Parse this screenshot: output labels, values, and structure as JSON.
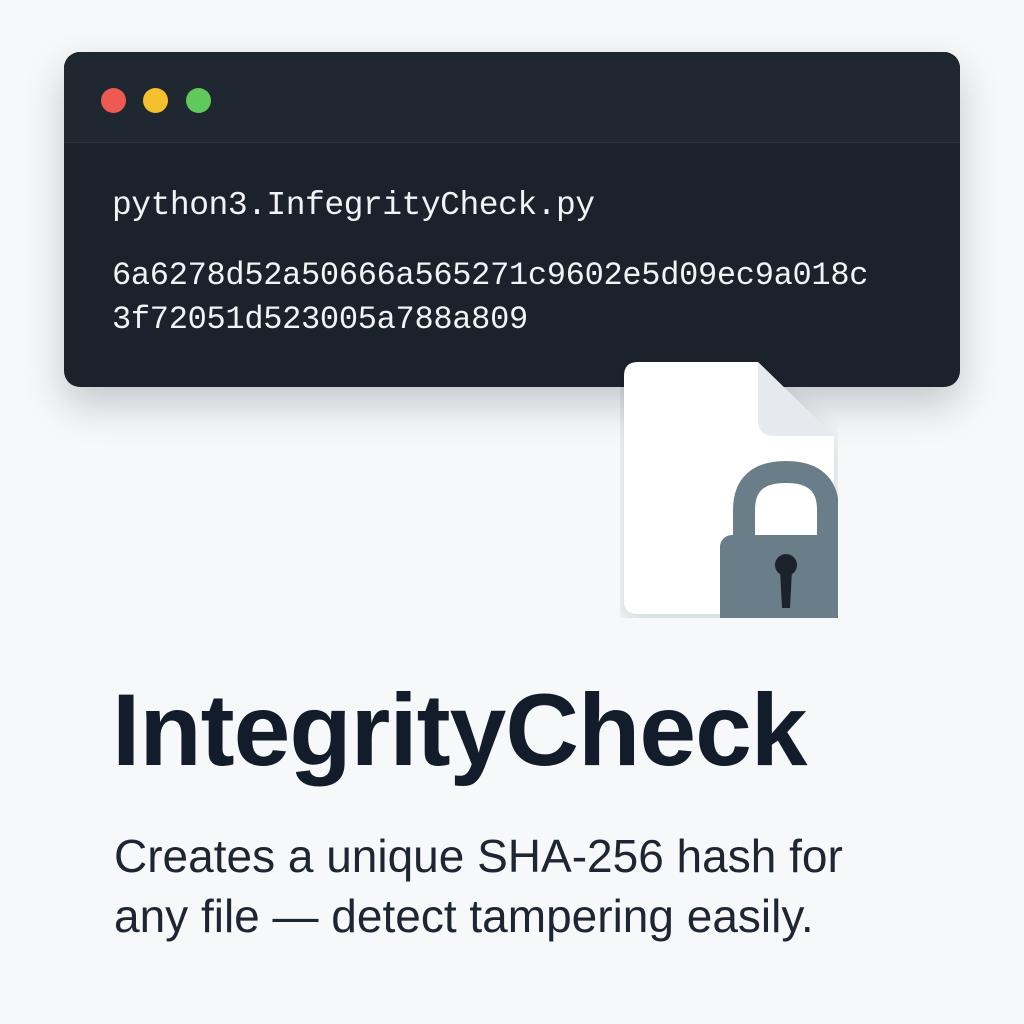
{
  "window": {
    "controls": [
      {
        "name": "close",
        "color": "#ee5a52"
      },
      {
        "name": "minimize",
        "color": "#f4c02e"
      },
      {
        "name": "maximize",
        "color": "#5fc95c"
      }
    ]
  },
  "terminal": {
    "command": "python3.InfegrityCheck.py",
    "hash_lines": [
      "6a6278d52a50666a565271c9602e5d09ec9a018c",
      "3f72051d523005a788a809"
    ]
  },
  "icons": {
    "file": "file-icon",
    "lock": "lock-icon"
  },
  "colors": {
    "terminal_bg": "#1b222c",
    "lock": "#6a7e89",
    "title": "#131c2b"
  },
  "headline": {
    "title": "IntegrityCheck",
    "subtitle_lines": [
      "Creates a unique SHA-256 hash for",
      "any file — detect tampering easily."
    ]
  }
}
